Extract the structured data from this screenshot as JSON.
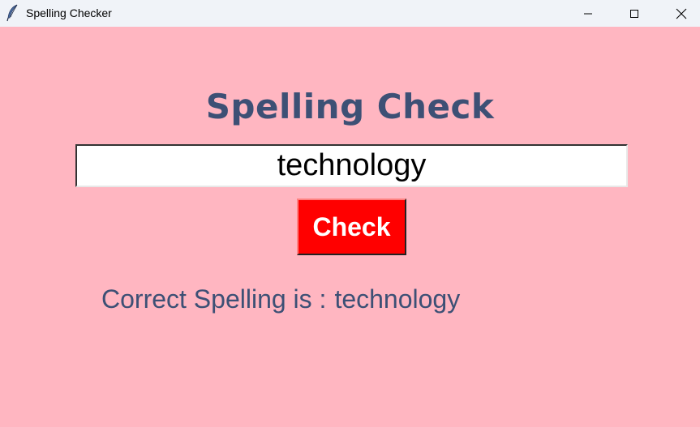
{
  "window": {
    "title": "Spelling Checker",
    "background": "#ffb6c1"
  },
  "titlebar": {
    "app_icon": "feather-icon",
    "minimize_icon": "minimize-icon",
    "maximize_icon": "maximize-icon",
    "close_icon": "close-icon"
  },
  "main": {
    "heading": "Spelling Check",
    "heading_color": "#3d5075",
    "input": {
      "value": "technology",
      "placeholder": ""
    },
    "check_button": {
      "label": "Check",
      "color": "#ff0000"
    },
    "result": {
      "label": "Correct Spelling is :",
      "value": "technology"
    }
  }
}
